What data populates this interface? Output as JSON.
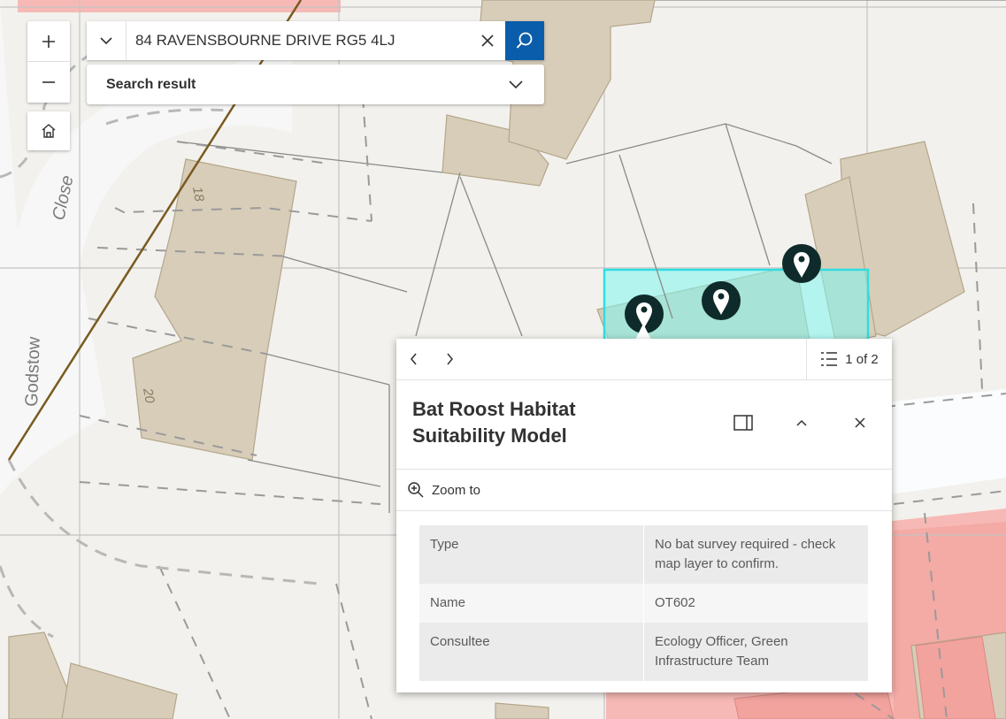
{
  "search": {
    "value": "84 RAVENSBOURNE DRIVE RG5 4LJ",
    "result_label": "Search result"
  },
  "map": {
    "street_labels": [
      "Close",
      "Godstow"
    ],
    "house_numbers": [
      "18",
      "20"
    ],
    "colors": {
      "background": "#f2f1ed",
      "building": "#d8cdb8",
      "highlight": "#7ff5ee",
      "pink_zone": "#f7b9b5",
      "marker": "#0f2a2a"
    }
  },
  "popup": {
    "pager": "1 of 2",
    "title": "Bat Roost Habitat Suitability Model",
    "zoom_to": "Zoom to",
    "rows": [
      {
        "key": "Type",
        "value": "No bat survey required - check map layer to confirm."
      },
      {
        "key": "Name",
        "value": "OT602"
      },
      {
        "key": "Consultee",
        "value": "Ecology Officer, Green Infrastructure Team"
      }
    ]
  }
}
